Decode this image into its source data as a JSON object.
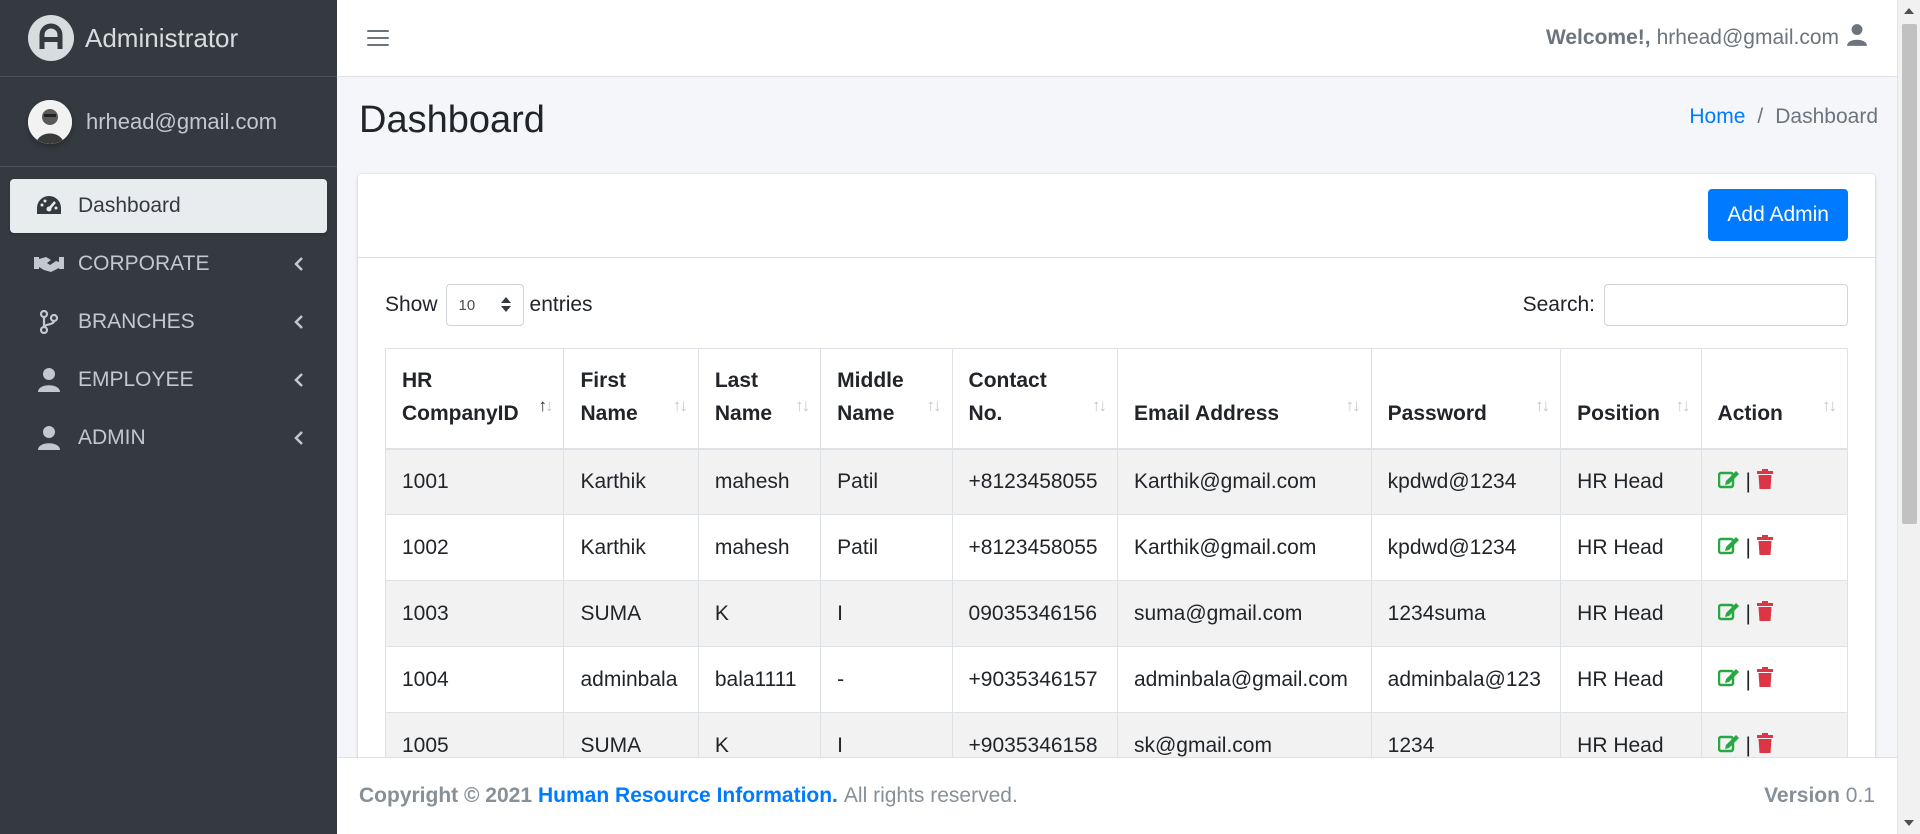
{
  "brand": {
    "title": "Administrator"
  },
  "user_panel": {
    "email": "hrhead@gmail.com"
  },
  "sidebar": {
    "items": [
      {
        "label": "Dashboard",
        "icon": "tachometer-icon",
        "active": true
      },
      {
        "label": "CORPORATE",
        "icon": "handshake-icon",
        "active": false
      },
      {
        "label": "BRANCHES",
        "icon": "code-branch-icon",
        "active": false
      },
      {
        "label": "EMPLOYEE",
        "icon": "user-icon",
        "active": false
      },
      {
        "label": "ADMIN",
        "icon": "user-icon",
        "active": false
      }
    ]
  },
  "topbar": {
    "welcome_label": "Welcome!,",
    "welcome_user": "hrhead@gmail.com"
  },
  "page": {
    "title": "Dashboard"
  },
  "breadcrumb": {
    "home": "Home",
    "separator": "/",
    "current": "Dashboard"
  },
  "card": {
    "add_button": "Add Admin"
  },
  "table_controls": {
    "show_label": "Show",
    "entries_value": "10",
    "entries_label": "entries",
    "search_label": "Search:"
  },
  "table": {
    "headers": [
      [
        "HR",
        "CompanyID"
      ],
      [
        "First",
        "Name"
      ],
      [
        "Last",
        "Name"
      ],
      [
        "Middle",
        "Name"
      ],
      [
        "Contact",
        "No."
      ],
      [
        "",
        "Email Address"
      ],
      [
        "",
        "Password"
      ],
      [
        "",
        "Position"
      ],
      [
        "",
        "Action"
      ]
    ],
    "rows": [
      [
        "1001",
        "Karthik",
        "mahesh",
        "Patil",
        "+8123458055",
        "Karthik@gmail.com",
        "kpdwd@1234",
        "HR Head"
      ],
      [
        "1002",
        "Karthik",
        "mahesh",
        "Patil",
        "+8123458055",
        "Karthik@gmail.com",
        "kpdwd@1234",
        "HR Head"
      ],
      [
        "1003",
        "SUMA",
        "K",
        "I",
        "09035346156",
        "suma@gmail.com",
        "1234suma",
        "HR Head"
      ],
      [
        "1004",
        "adminbala",
        "bala1111",
        "-",
        "+9035346157",
        "adminbala@gmail.com",
        "adminbala@123",
        "HR Head"
      ],
      [
        "1005",
        "SUMA",
        "K",
        "I",
        "+9035346158",
        "sk@gmail.com",
        "1234",
        "HR Head"
      ]
    ],
    "action_separator": "|"
  },
  "footer": {
    "copyright": "Copyright © 2021",
    "company": "Human Resource Information.",
    "rights": "All rights reserved.",
    "version_label": "Version",
    "version_value": "0.1"
  },
  "colors": {
    "sidebar_bg": "#343a40",
    "primary": "#007bff",
    "edit": "#28a745",
    "delete": "#dc3545"
  }
}
